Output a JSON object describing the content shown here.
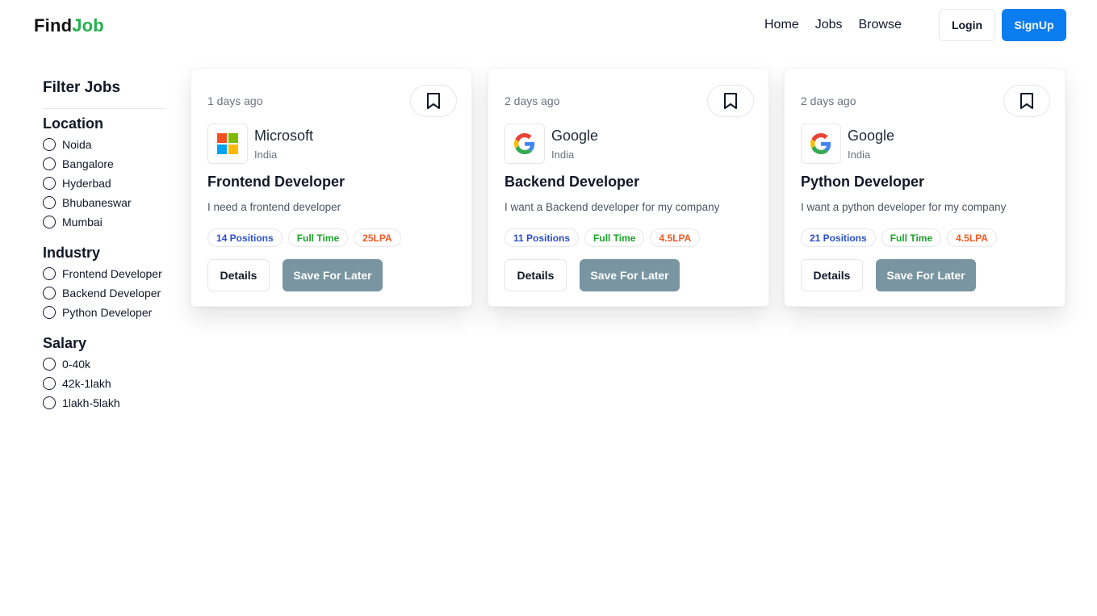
{
  "brand": {
    "part1": "Find",
    "part2": "Job"
  },
  "nav": {
    "home": "Home",
    "jobs": "Jobs",
    "browse": "Browse"
  },
  "auth": {
    "login": "Login",
    "signup": "SignUp"
  },
  "filters": {
    "title": "Filter Jobs",
    "groups": [
      {
        "title": "Location",
        "options": [
          "Noida",
          "Bangalore",
          "Hyderbad",
          "Bhubaneswar",
          "Mumbai"
        ]
      },
      {
        "title": "Industry",
        "options": [
          "Frontend Developer",
          "Backend Developer",
          "Python Developer"
        ]
      },
      {
        "title": "Salary",
        "options": [
          "0-40k",
          "42k-1lakh",
          "1lakh-5lakh"
        ]
      }
    ]
  },
  "jobs": [
    {
      "posted": "1 days ago",
      "company": "Microsoft",
      "logo_icon": "microsoft-logo-icon",
      "location": "India",
      "title": "Frontend Developer",
      "description": "I need a frontend developer",
      "positions": "14 Positions",
      "job_type": "Full Time",
      "salary": "25LPA",
      "details_label": "Details",
      "save_label": "Save For Later"
    },
    {
      "posted": "2 days ago",
      "company": "Google",
      "logo_icon": "google-logo-icon",
      "location": "India",
      "title": "Backend Developer",
      "description": "I want a Backend developer for my company",
      "positions": "11 Positions",
      "job_type": "Full Time",
      "salary": "4.5LPA",
      "details_label": "Details",
      "save_label": "Save For Later"
    },
    {
      "posted": "2 days ago",
      "company": "Google",
      "logo_icon": "google-logo-icon",
      "location": "India",
      "title": "Python Developer",
      "description": "I want a python developer for my company",
      "positions": "21 Positions",
      "job_type": "Full Time",
      "salary": "4.5LPA",
      "details_label": "Details",
      "save_label": "Save For Later"
    }
  ],
  "colors": {
    "brand_accent": "#22b14c",
    "primary_button": "#0b7df0",
    "save_button": "#7895a1",
    "positions_badge": "#2b4fc9",
    "type_badge": "#1aa32a",
    "salary_badge": "#f05a22"
  }
}
